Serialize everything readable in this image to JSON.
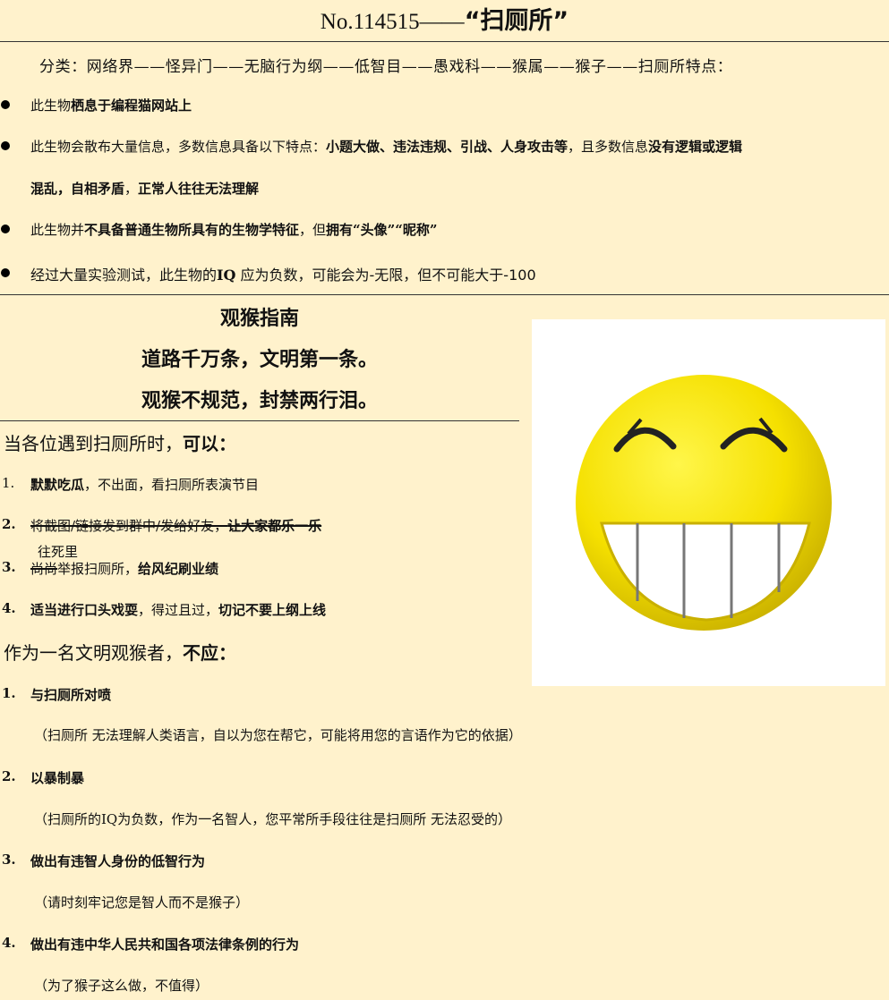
{
  "title": {
    "number": "No.114515——",
    "name": "“扫厕所”"
  },
  "classification": "分类：网络界——怪异门——无脑行为纲——低智目——愚戏科——猴属——猴子——扫厕所特点：",
  "bullets": [
    {
      "t1": "此生物",
      "b1": "栖息于编程猫网站上"
    },
    {
      "t1": "此生物会散布大量信息，多数信息具备以下特点：",
      "b1": "小题大做、违法违规、引战、人身攻击等",
      "t2": "，且多数信息",
      "b2": "没有逻辑或逻辑"
    },
    {
      "b1": "混乱，自相矛盾",
      "t1": "，",
      "b2": "正常人往往无法理解"
    },
    {
      "t1": "此生物并",
      "b1": "不具备普通生物所具有的生物学特征",
      "t2": "，但",
      "b2": "拥有“头像”“昵称”"
    },
    {
      "t1": "经过大量实验测试，此生物的",
      "b1": "IQ",
      "t2": "应为负数，可能会为-无限，但不可能大于-100"
    }
  ],
  "guide": {
    "title": "观猴指南",
    "motto_1": "道路千万条，文明第一条。",
    "motto_2": "观猴不规范，封禁两行泪。"
  },
  "can_do": {
    "heading_1": "当各位遇到扫厕所时，",
    "heading_2": "可以：",
    "items": [
      {
        "num": "1.",
        "b1": "默默吃瓜",
        "t1": "，不出面，看扫厕所表演节目"
      },
      {
        "num": "2.",
        "s1": "将截图/链接发到群中/发给好友，",
        "s2": "让大家都乐一乐"
      },
      {
        "num": "3.",
        "s1": "尚尚",
        "t1": "举报扫厕所，",
        "b1": "给风纪刷业绩"
      },
      {
        "num": "4.",
        "b1": "适当进行口头戏耍",
        "t1": "，得过且过，",
        "b2": "切记不要上纲上线"
      }
    ],
    "handwritten_note": "往死里"
  },
  "should_not": {
    "heading_1": "作为一名文明观猴者，",
    "heading_2": "不应：",
    "items": [
      {
        "num": "1.",
        "text": "与扫厕所对喷",
        "note": "（扫厕所 无法理解人类语言，自以为您在帮它，可能将用您的言语作为它的依据）"
      },
      {
        "num": "2.",
        "text": "以暴制暴",
        "note": "（扫厕所的IQ为负数，作为一名智人，您平常所手段往往是扫厕所 无法忍受的）"
      },
      {
        "num": "3.",
        "text": "做出有违智人身份的低智行为",
        "note": "（请时刻牢记您是智人而不是猴子）"
      },
      {
        "num": "4.",
        "text": "做出有违中华人民共和国各项法律条例的行为",
        "note": "（为了猴子这么做，不值得）"
      }
    ]
  },
  "image": {
    "icon": "grinning-smiley-face-icon",
    "face_color": "#f5e000",
    "background": "#ffffff"
  },
  "colors": {
    "page_background": "#fff2cc",
    "text": "#111111"
  }
}
